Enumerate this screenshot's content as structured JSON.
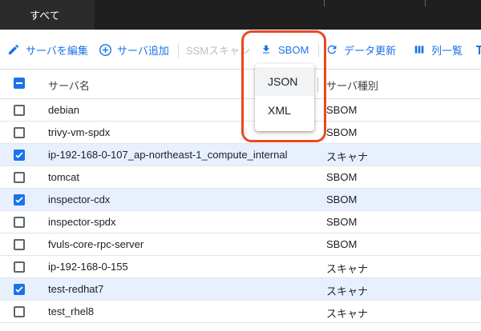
{
  "tabs": {
    "active_label": "すべて"
  },
  "toolbar": {
    "edit_label": "サーバを編集",
    "add_label": "サーバ追加",
    "ssm_label": "SSMスキャン",
    "sbom_label": "SBOM",
    "refresh_label": "データ更新",
    "columns_label": "列一覧"
  },
  "table": {
    "header": {
      "name": "サーバ名",
      "type": "サーバ種別"
    },
    "rows": [
      {
        "name": "debian",
        "type": "SBOM",
        "checked": false
      },
      {
        "name": "trivy-vm-spdx",
        "type": "SBOM",
        "checked": false
      },
      {
        "name": "ip-192-168-0-107_ap-northeast-1_compute_internal",
        "type": "スキャナ",
        "checked": true
      },
      {
        "name": "tomcat",
        "type": "SBOM",
        "checked": false
      },
      {
        "name": "inspector-cdx",
        "type": "SBOM",
        "checked": true
      },
      {
        "name": "inspector-spdx",
        "type": "SBOM",
        "checked": false
      },
      {
        "name": "fvuls-core-rpc-server",
        "type": "SBOM",
        "checked": false
      },
      {
        "name": "ip-192-168-0-155",
        "type": "スキャナ",
        "checked": false
      },
      {
        "name": "test-redhat7",
        "type": "スキャナ",
        "checked": true
      },
      {
        "name": "test_rhel8",
        "type": "スキャナ",
        "checked": false
      }
    ]
  },
  "menu": {
    "items": [
      "JSON",
      "XML"
    ]
  },
  "colors": {
    "accent": "#1a73e8",
    "highlight": "#e8491f",
    "selected_row": "#e8f0fe"
  }
}
